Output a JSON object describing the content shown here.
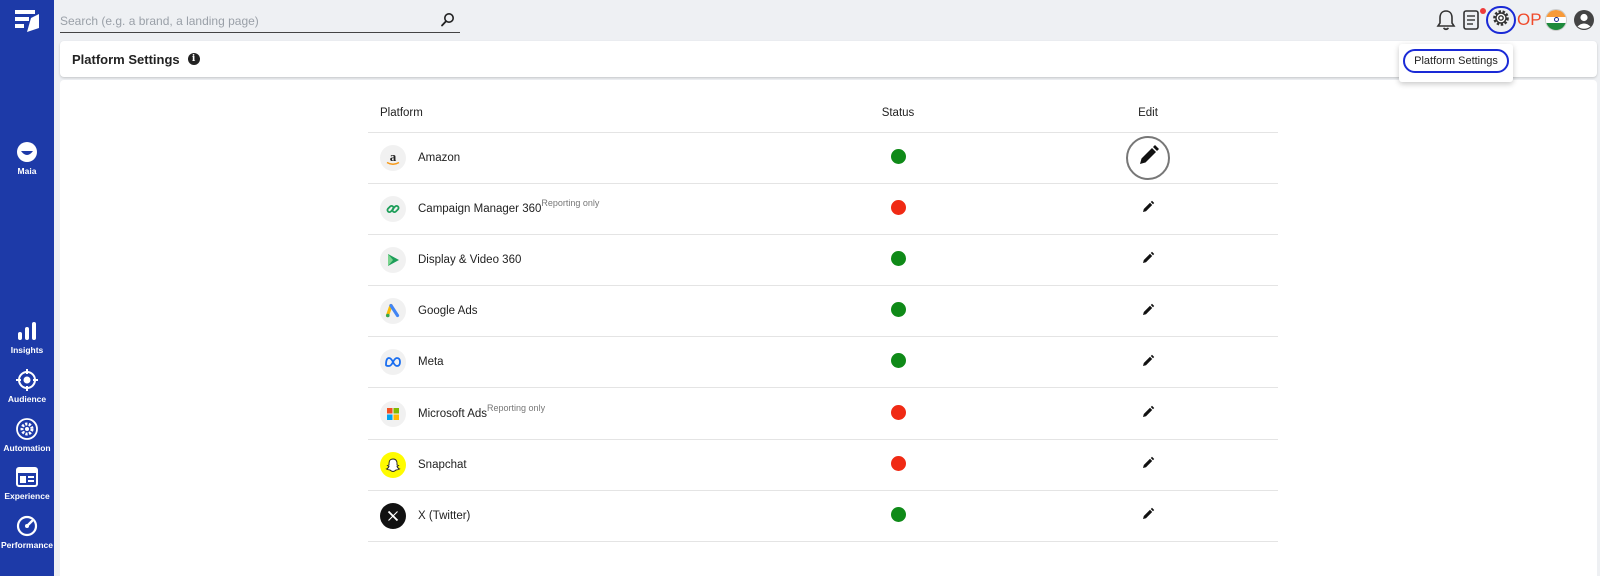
{
  "search": {
    "placeholder": "Search (e.g. a brand, a landing page)"
  },
  "sidebar": {
    "items": [
      {
        "label": "Maia",
        "icon": "maia-icon"
      },
      {
        "label": "Insights",
        "icon": "bar-chart-icon"
      },
      {
        "label": "Audience",
        "icon": "target-icon"
      },
      {
        "label": "Automation",
        "icon": "gear-badge-icon"
      },
      {
        "label": "Experience",
        "icon": "browser-window-icon"
      },
      {
        "label": "Performance",
        "icon": "gauge-icon"
      }
    ]
  },
  "topbar": {
    "user_initials": "OP"
  },
  "header": {
    "title": "Platform Settings"
  },
  "dropdown": {
    "item": "Platform Settings"
  },
  "table": {
    "columns": {
      "platform": "Platform",
      "status": "Status",
      "edit": "Edit"
    },
    "rows": [
      {
        "name": "Amazon",
        "note": "",
        "status": "green",
        "icon": "amazon-icon"
      },
      {
        "name": "Campaign Manager 360",
        "note": "Reporting only",
        "status": "red",
        "icon": "campaign-manager-icon"
      },
      {
        "name": "Display & Video 360",
        "note": "",
        "status": "green",
        "icon": "display-video-icon"
      },
      {
        "name": "Google Ads",
        "note": "",
        "status": "green",
        "icon": "google-ads-icon"
      },
      {
        "name": "Meta",
        "note": "",
        "status": "green",
        "icon": "meta-icon"
      },
      {
        "name": "Microsoft Ads",
        "note": "Reporting only",
        "status": "red",
        "icon": "microsoft-icon"
      },
      {
        "name": "Snapchat",
        "note": "",
        "status": "red",
        "icon": "snapchat-icon"
      },
      {
        "name": "X (Twitter)",
        "note": "",
        "status": "green",
        "icon": "x-twitter-icon"
      }
    ]
  },
  "colors": {
    "sidebar": "#1d3aa8",
    "status_green": "#0f8a18",
    "status_red": "#f02a14",
    "accent_ring": "#1a2ad6",
    "initials": "#f04a2a"
  }
}
